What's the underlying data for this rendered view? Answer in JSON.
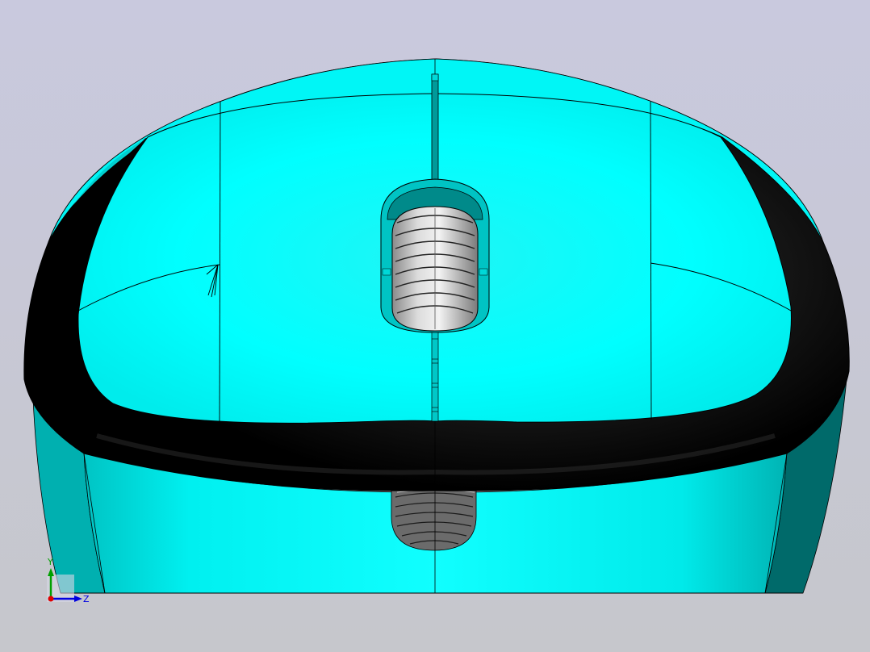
{
  "viewport": {
    "background_top": "#c9c9de",
    "background_bottom": "#c6c7cc",
    "model_colors": {
      "shell": "#00ffff",
      "shell_shadow": "#00aaaa",
      "shell_dark_side": "#006666",
      "rubber_grip": "#000000",
      "scroll_wheel": "#c8c8c8",
      "edges": "#000000"
    }
  },
  "triad": {
    "x_color": "#e00000",
    "y_color": "#00a000",
    "z_color": "#0000e0",
    "y_label": "Y",
    "z_label": "Z"
  }
}
